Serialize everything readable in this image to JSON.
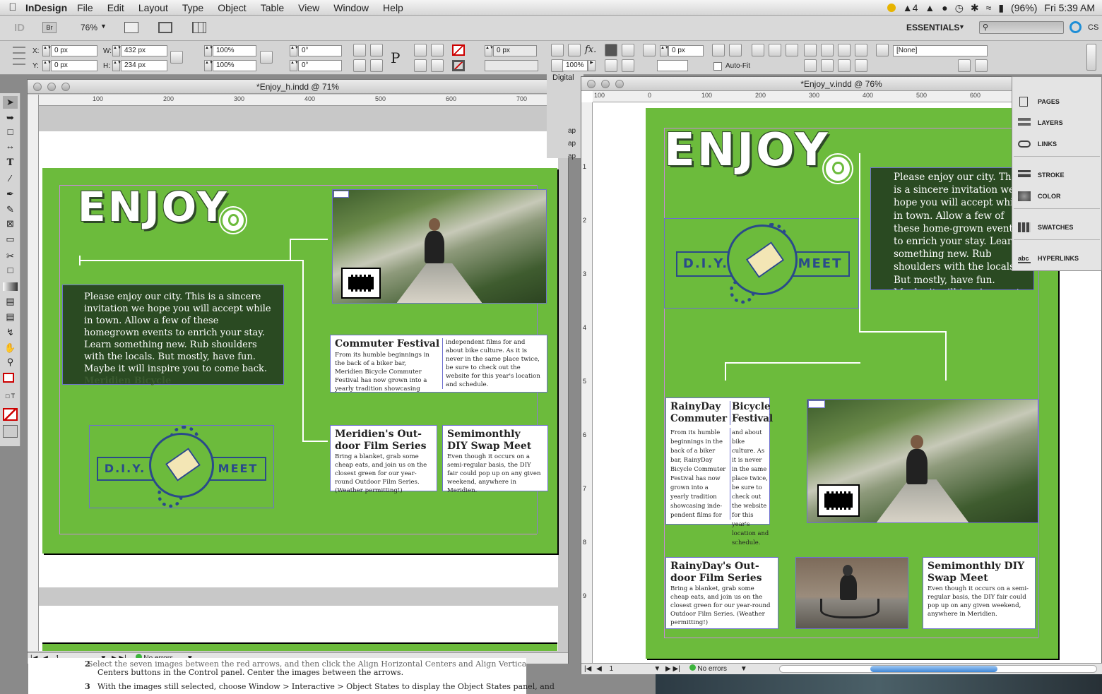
{
  "menubar": {
    "app": "InDesign",
    "items": [
      "File",
      "Edit",
      "Layout",
      "Type",
      "Object",
      "Table",
      "View",
      "Window",
      "Help"
    ],
    "status_ai": "4",
    "battery": "(96%)",
    "clock": "Fri 5:39 AM"
  },
  "appbar": {
    "logo": "ID",
    "bridge": "Br",
    "zoom": "76%",
    "workspace": "ESSENTIALS",
    "search_placeholder": "",
    "cs_label": "CS"
  },
  "control": {
    "x_label": "X:",
    "y_label": "Y:",
    "w_label": "W:",
    "h_label": "H:",
    "x_value": "0 px",
    "y_value": "0 px",
    "w_value": "432 px",
    "h_value": "234 px",
    "scale_x": "100%",
    "scale_y": "100%",
    "rotate": "0°",
    "shear": "0°",
    "stroke_weight": "0 px",
    "opacity": "100%",
    "offset": "0 px",
    "autofit": "Auto-Fit",
    "style": "[None]"
  },
  "win_left": {
    "title": "*Enjoy_h.indd @ 71%",
    "ruler": [
      "100",
      "200",
      "300",
      "400",
      "500",
      "600",
      "700"
    ],
    "page_number": "1",
    "preflight": "No errors"
  },
  "win_right": {
    "title": "*Enjoy_v.indd @ 76%",
    "ruler": [
      "100",
      "0",
      "100",
      "200",
      "300",
      "400",
      "500",
      "600"
    ],
    "ruler_v": [
      "1",
      "2",
      "3",
      "4",
      "5",
      "6",
      "7",
      "8",
      "9"
    ],
    "page_number": "1",
    "preflight": "No errors"
  },
  "layout_h": {
    "enjoy": "ENJOY",
    "intro": "Please enjoy our city. This is a sincere invitation we hope you will accept while in town. Allow a few of these homegrown events to enrich your stay. Learn something new. Rub shoulders with the locals. But mostly, have fun. Maybe it will inspire you to come back.",
    "overset": "Meridien Bicycle",
    "commuter_title": "Commuter Festival",
    "commuter_body_1": "From its humble beginnings in the back of a biker bar, Meridien Bicycle Commuter Festival has now grown into a yearly tradition showcasing",
    "commuter_body_2": "independent films for and about bike culture. As it is never in the same place twice, be sure to check out the website for this year's location and schedule.",
    "film_title": "Meridien's Out-door Film Series",
    "film_body": "Bring a blanket, grab some cheap eats, and join us on the closest green for our year-round Outdoor Film Series. (Weather permitting!)",
    "swap_title": "Semimonthly DIY Swap Meet",
    "swap_body": "Even though it occurs on a semi-regular basis, the DIY fair could pop up on any given weekend, anywhere in Meridien.",
    "diy_left": "D.I.Y.",
    "diy_right": "MEET"
  },
  "layout_v": {
    "enjoy": "ENJOY",
    "intro": "Please enjoy our city. This is a sincere invitation we hope you will accept while in town. Allow a few of these home-grown events to enrich your stay. Learn something new. Rub shoulders with the locals. But mostly, have fun. Maybe it will inspire you to come back.",
    "commuter_title_1": "RainyDay Commuter",
    "commuter_title_2": "Bicycle Festival",
    "commuter_body_1": "From its humble beginnings in the back of a biker bar, RainyDay Bicycle Commuter Festival has now grown into a yearly tradition showcasing inde-pendent films for",
    "commuter_body_2": "and about bike culture. As it is never in the same place twice, be sure to check out the website for this year's location and schedule.",
    "film_title": "RainyDay's Out-door Film Series",
    "film_body": "Bring a blanket, grab some cheap eats, and join us on the closest green for our year-round Outdoor Film Series. (Weather permitting!)",
    "swap_title": "Semimonthly DIY Swap Meet",
    "swap_body": "Even though it occurs on a semi-regular basis, the DIY fair could pop up on any given weekend, anywhere in Meridien.",
    "diy_left": "D.I.Y.",
    "diy_right": "MEET"
  },
  "panel": {
    "items": [
      "PAGES",
      "LAYERS",
      "LINKS",
      "STROKE",
      "COLOR",
      "SWATCHES",
      "HYPERLINKS"
    ],
    "hidden_panel_edge": "Digital",
    "hidden_panel_rows": [
      "ap",
      "ap",
      "ap"
    ]
  },
  "background_doc": {
    "line_1": "Select the seven images between the red arrows, and then click the Align Horizontal Centers and Align Vertical",
    "line_2": "Centers buttons in the Control panel. Center the images between the arrows.",
    "step_2": "2",
    "step_3": "3",
    "line_3": "With the images still selected, choose Window > Interactive > Object States to display the Object States panel, and"
  },
  "colors": {
    "page_green": "#6cbb3c",
    "dark_green": "#2a4a22",
    "frame_blue": "#6d6fcf",
    "navy": "#2a4a8a"
  }
}
